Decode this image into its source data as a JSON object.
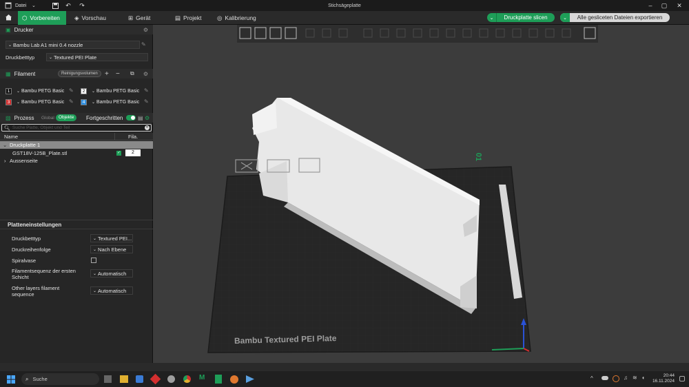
{
  "window": {
    "title": "Stichsägeplatte",
    "menu_label": "Datei"
  },
  "toolbar": {
    "tabs": [
      {
        "label": "Vorbereiten"
      },
      {
        "label": "Vorschau"
      },
      {
        "label": "Gerät"
      },
      {
        "label": "Projekt"
      },
      {
        "label": "Kalibrierung"
      }
    ],
    "slice_button": "Druckplatte slicen",
    "export_button": "Alle gesliceten Dateien exportieren",
    "accent_color": "#1e9e58"
  },
  "sidebar": {
    "printer": {
      "heading": "Drucker",
      "printer_value": "Bambu Lab A1 mini 0.4 nozzle",
      "bed_label": "Druckbetttyp",
      "bed_value": "Textured PEI Plate"
    },
    "filament": {
      "heading": "Filament",
      "purge_button": "Reinigungsvolumen",
      "slots": [
        {
          "number": "1",
          "name": "Bambu PETG Basic",
          "color": "#111111"
        },
        {
          "number": "2",
          "name": "Bambu PETG Basic",
          "color": "#ffffff"
        },
        {
          "number": "3",
          "name": "Bambu PETG Basic",
          "color": "#d32f2f"
        },
        {
          "number": "4",
          "name": "Bambu PETG Basic",
          "color": "#2f8fe0"
        }
      ]
    },
    "process": {
      "heading": "Prozess",
      "global_label": "Global",
      "objects_label": "Objekte",
      "advanced_label": "Fortgeschritten",
      "search_placeholder": "Suche Platte, Objekt und Teil"
    },
    "object_list": {
      "col_name": "Name",
      "col_fila": "Fila.",
      "plate_row": "Druckplatte 1",
      "object_row": "GST18V-125B_Plate.stl",
      "object_filament": "2",
      "outside_row": "Aussenseite"
    },
    "plate_settings": {
      "heading": "Platteneinstellungen",
      "rows": [
        {
          "label": "Druckbetttyp",
          "value": "Textured PEI..."
        },
        {
          "label": "Druckreihenfolge",
          "value": "Nach Ebene"
        },
        {
          "label": "Spiralvase",
          "value": ""
        },
        {
          "label": "Filamentsequenz der ersten Schicht",
          "value": "Automatisch"
        },
        {
          "label": "Other layers filament sequence",
          "value": "Automatisch"
        }
      ]
    }
  },
  "viewport": {
    "plate_text": "Bambu Textured PEI Plate",
    "plate_number": "01"
  },
  "taskbar": {
    "search_placeholder": "Suche",
    "time": "20:44",
    "date": "16.11.2024"
  }
}
